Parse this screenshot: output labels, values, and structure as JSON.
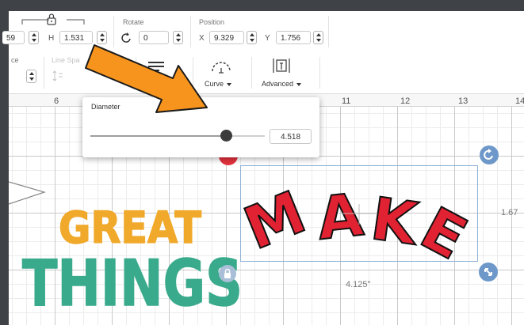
{
  "toolbar": {
    "size_w_value": "59",
    "size_h_label": "H",
    "size_h_value": "1.531",
    "rotate_label": "Rotate",
    "rotate_value": "0",
    "position_label": "Position",
    "x_label": "X",
    "x_value": "9.329",
    "y_label": "Y",
    "y_value": "1.756"
  },
  "text_toolbar": {
    "spacing_partial_label": "ce",
    "line_spacing_label": "Line Spa",
    "curve_label": "Curve",
    "advanced_label": "Advanced"
  },
  "ruler": {
    "ticks": [
      "6",
      "11",
      "12",
      "13",
      "14"
    ]
  },
  "curve_popup": {
    "diameter_label": "Diameter",
    "diameter_value": "4.518",
    "slider_fraction": 0.78
  },
  "canvas": {
    "great_text": "GREAT",
    "things_text": "THINGS",
    "make_text": "MAKE",
    "width_dimension": "4.125\"",
    "height_dimension": "1.67",
    "colors": {
      "great": "#f0a92a",
      "things": "#3aaa8c",
      "make": "#e02232",
      "arrow": "#f7941d",
      "handle": "#6d98c9"
    }
  },
  "icons": {
    "lock": "lock-icon",
    "rotate": "rotate-icon",
    "align": "align-icon",
    "curve": "curve-icon",
    "advanced": "advanced-icon"
  }
}
